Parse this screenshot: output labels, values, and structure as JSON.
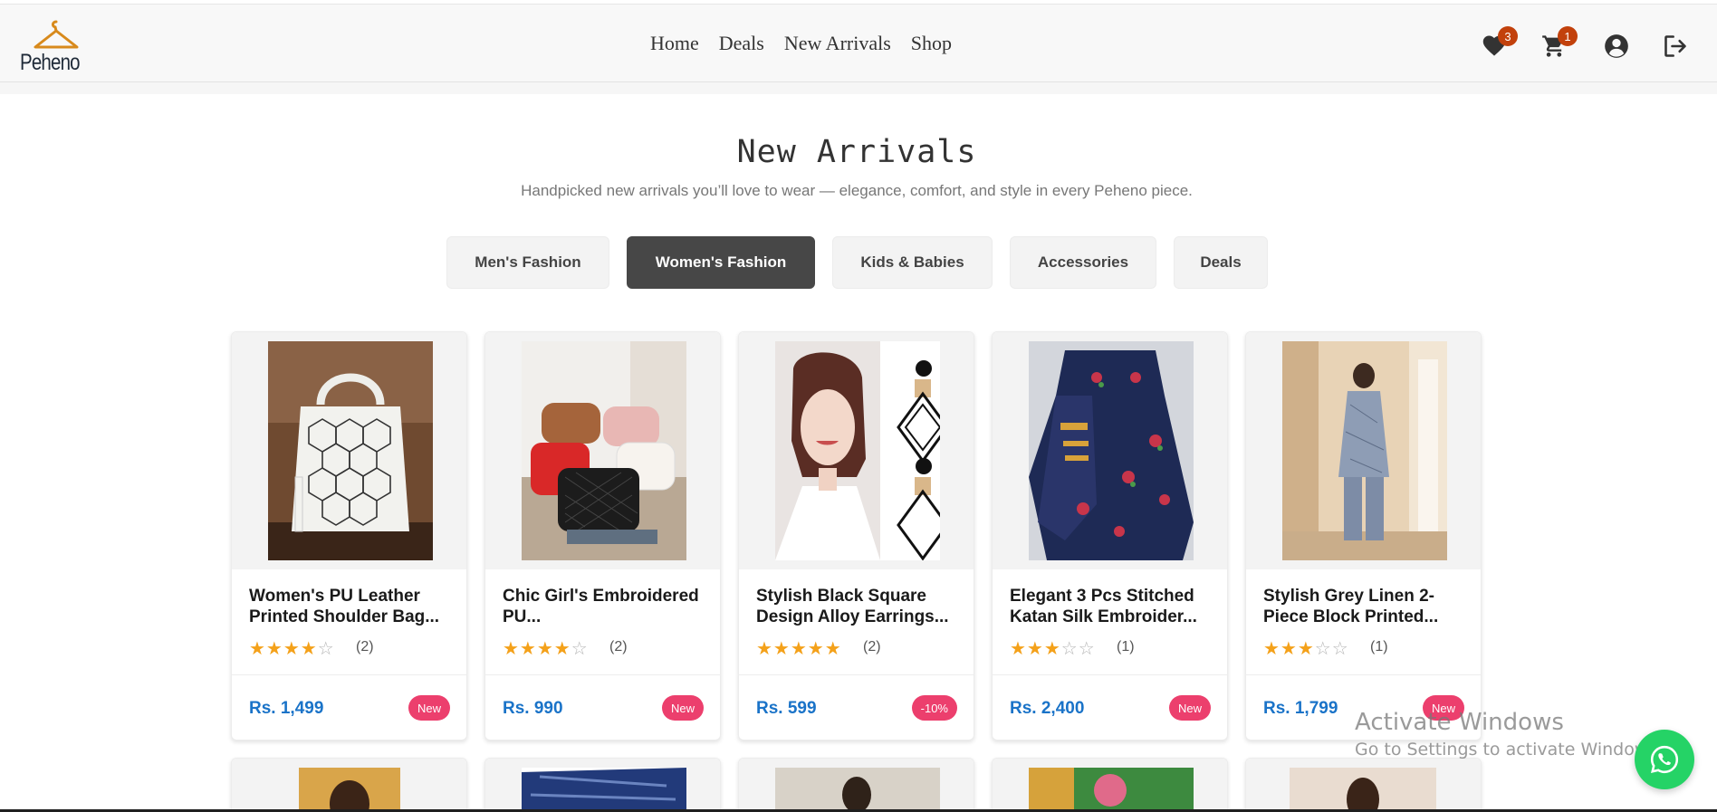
{
  "brand": {
    "logo_text": "Peheno",
    "accent_color": "#d88a1c"
  },
  "nav": {
    "items": [
      {
        "label": "Home"
      },
      {
        "label": "Deals"
      },
      {
        "label": "New Arrivals"
      },
      {
        "label": "Shop"
      }
    ]
  },
  "header_icons": {
    "wishlist": {
      "icon": "heart-icon",
      "count": "3"
    },
    "cart": {
      "icon": "cart-icon",
      "count": "1"
    },
    "account": {
      "icon": "user-circle-icon"
    },
    "logout": {
      "icon": "logout-icon"
    }
  },
  "section": {
    "title": "New Arrivals",
    "subtitle": "Handpicked new arrivals you’ll love to wear — elegance, comfort, and style in every Peheno piece."
  },
  "tabs": [
    {
      "label": "Men's Fashion",
      "active": false
    },
    {
      "label": "Women's Fashion",
      "active": true
    },
    {
      "label": "Kids & Babies",
      "active": false
    },
    {
      "label": "Accessories",
      "active": false
    },
    {
      "label": "Deals",
      "active": false
    }
  ],
  "products": [
    {
      "name": "Women's PU Leather Printed Shoulder Bag...",
      "rating": 4,
      "reviews": "(2)",
      "price": "Rs. 1,499",
      "tag": "New"
    },
    {
      "name": "Chic Girl's Embroidered PU...",
      "rating": 4,
      "reviews": "(2)",
      "price": "Rs. 990",
      "tag": "New"
    },
    {
      "name": "Stylish Black Square Design Alloy Earrings...",
      "rating": 5,
      "reviews": "(2)",
      "price": "Rs. 599",
      "tag": "-10%"
    },
    {
      "name": "Elegant 3 Pcs Stitched Katan Silk Embroider...",
      "rating": 3,
      "reviews": "(1)",
      "price": "Rs. 2,400",
      "tag": "New"
    },
    {
      "name": "Stylish Grey Linen 2-Piece Block Printed...",
      "rating": 3,
      "reviews": "(1)",
      "price": "Rs. 1,799",
      "tag": "New"
    }
  ],
  "colors": {
    "price": "#1a73c8",
    "tag": "#ec3f6d",
    "star": "#f4a11a",
    "active_tab": "#474747",
    "whatsapp": "#25d366"
  },
  "watermark": {
    "line1": "Activate Windows",
    "line2": "Go to Settings to activate Windows."
  },
  "floating": {
    "icon": "whatsapp-icon"
  }
}
